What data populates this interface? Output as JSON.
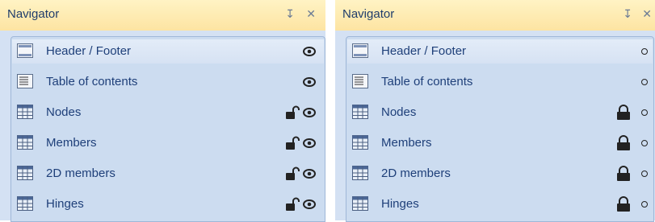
{
  "panels": [
    {
      "title": "Navigator",
      "pin_icon": "pin-icon",
      "close_icon": "close-icon",
      "items": [
        {
          "label": "Header / Footer",
          "icon": "header-footer-icon",
          "lock": null
        },
        {
          "label": "Table of contents",
          "icon": "table-of-contents-icon",
          "lock": null
        },
        {
          "label": "Nodes",
          "icon": "grid-table-icon",
          "lock": "unlocked"
        },
        {
          "label": "Members",
          "icon": "grid-table-icon",
          "lock": "unlocked"
        },
        {
          "label": "2D members",
          "icon": "grid-table-icon",
          "lock": "unlocked"
        },
        {
          "label": "Hinges",
          "icon": "grid-table-icon",
          "lock": "unlocked"
        }
      ],
      "visibility_icon": "eye-icon"
    },
    {
      "title": "Navigator",
      "pin_icon": "pin-icon",
      "close_icon": "close-icon",
      "items": [
        {
          "label": "Header / Footer",
          "icon": "header-footer-icon",
          "lock": null
        },
        {
          "label": "Table of contents",
          "icon": "table-of-contents-icon",
          "lock": null
        },
        {
          "label": "Nodes",
          "icon": "grid-table-icon",
          "lock": "locked"
        },
        {
          "label": "Members",
          "icon": "grid-table-icon",
          "lock": "locked"
        },
        {
          "label": "2D members",
          "icon": "grid-table-icon",
          "lock": "locked"
        },
        {
          "label": "Hinges",
          "icon": "grid-table-icon",
          "lock": "locked"
        }
      ],
      "visibility_icon": "circle-icon"
    }
  ]
}
